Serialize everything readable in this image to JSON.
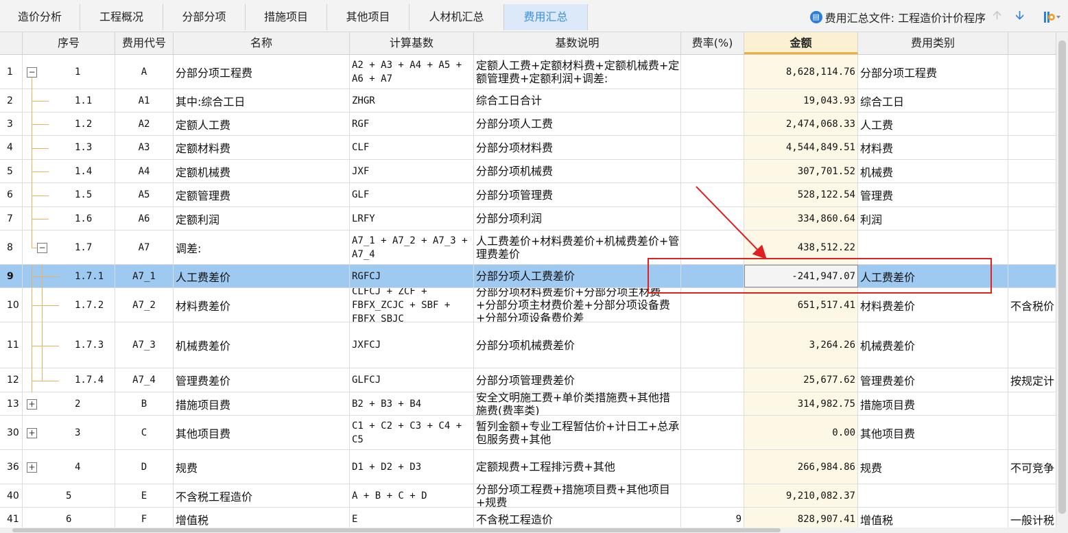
{
  "tabs": [
    {
      "label": "造价分析",
      "active": false
    },
    {
      "label": "工程概况",
      "active": false
    },
    {
      "label": "分部分项",
      "active": false
    },
    {
      "label": "措施项目",
      "active": false
    },
    {
      "label": "其他项目",
      "active": false
    },
    {
      "label": "人材机汇总",
      "active": false
    },
    {
      "label": "费用汇总",
      "active": true
    }
  ],
  "file_label": "费用汇总文件: 工程造价计价程序",
  "icons": {
    "file": "document-icon",
    "up": "arrow-up-icon",
    "down": "arrow-down-icon",
    "settings": "settings-icon"
  },
  "columns": [
    "",
    "序号",
    "费用代号",
    "名称",
    "计算基数",
    "基数说明",
    "费率(%)",
    "金额",
    "费用类别",
    ""
  ],
  "rows": [
    {
      "row": "1",
      "seq": "1",
      "code": "A",
      "name": "分部分项工程费",
      "base": "A2 + A3 + A4 + A5 + A6 + A7",
      "desc": "定额人工费+定额材料费+定额机械费+定额管理费+定额利润+调差:",
      "rate": "",
      "amount": "8,628,114.76",
      "category": "分部分项工程费",
      "note": ""
    },
    {
      "row": "2",
      "seq": "1.1",
      "code": "A1",
      "name": "其中:综合工日",
      "base": "ZHGR",
      "desc": "综合工日合计",
      "rate": "",
      "amount": "19,043.93",
      "category": "综合工日",
      "note": ""
    },
    {
      "row": "3",
      "seq": "1.2",
      "code": "A2",
      "name": "定额人工费",
      "base": "RGF",
      "desc": "分部分项人工费",
      "rate": "",
      "amount": "2,474,068.33",
      "category": "人工费",
      "note": ""
    },
    {
      "row": "4",
      "seq": "1.3",
      "code": "A3",
      "name": "定额材料费",
      "base": "CLF",
      "desc": "分部分项材料费",
      "rate": "",
      "amount": "4,544,849.51",
      "category": "材料费",
      "note": ""
    },
    {
      "row": "5",
      "seq": "1.4",
      "code": "A4",
      "name": "定额机械费",
      "base": "JXF",
      "desc": "分部分项机械费",
      "rate": "",
      "amount": "307,701.52",
      "category": "机械费",
      "note": ""
    },
    {
      "row": "6",
      "seq": "1.5",
      "code": "A5",
      "name": "定额管理费",
      "base": "GLF",
      "desc": "分部分项管理费",
      "rate": "",
      "amount": "528,122.54",
      "category": "管理费",
      "note": ""
    },
    {
      "row": "7",
      "seq": "1.6",
      "code": "A6",
      "name": "定额利润",
      "base": "LRFY",
      "desc": "分部分项利润",
      "rate": "",
      "amount": "334,860.64",
      "category": "利润",
      "note": ""
    },
    {
      "row": "8",
      "seq": "1.7",
      "code": "A7",
      "name": "调差:",
      "base": "A7_1 + A7_2 + A7_3 + A7_4",
      "desc": "人工费差价+材料费差价+机械费差价+管理费差价",
      "rate": "",
      "amount": "438,512.22",
      "category": "",
      "note": ""
    },
    {
      "row": "9",
      "seq": "1.7.1",
      "code": "A7_1",
      "name": "人工费差价",
      "base": "RGFCJ",
      "desc": "分部分项人工费差价",
      "rate": "",
      "amount": "-241,947.07",
      "category": "人工费差价",
      "note": ""
    },
    {
      "row": "10",
      "seq": "1.7.2",
      "code": "A7_2",
      "name": "材料费差价",
      "base": "CLFCJ + ZCF + FBFX_ZCJC + SBF + FBFX_SBJC",
      "desc": "分部分项材料费差价+分部分项主材费+分部分项主材费价差+分部分项设备费+分部分项设备费价差",
      "rate": "",
      "amount": "651,517.41",
      "category": "材料费差价",
      "note": "不含税价"
    },
    {
      "row": "11",
      "seq": "1.7.3",
      "code": "A7_3",
      "name": "机械费差价",
      "base": "JXFCJ",
      "desc": "分部分项机械费差价",
      "rate": "",
      "amount": "3,264.26",
      "category": "机械费差价",
      "note": ""
    },
    {
      "row": "12",
      "seq": "1.7.4",
      "code": "A7_4",
      "name": "管理费差价",
      "base": "GLFCJ",
      "desc": "分部分项管理费差价",
      "rate": "",
      "amount": "25,677.62",
      "category": "管理费差价",
      "note": "按规定计"
    },
    {
      "row": "13",
      "seq": "2",
      "code": "B",
      "name": "措施项目费",
      "base": "B2 + B3 + B4",
      "desc": "安全文明施工费+单价类措施费+其他措施费(费率类)",
      "rate": "",
      "amount": "314,982.75",
      "category": "措施项目费",
      "note": ""
    },
    {
      "row": "30",
      "seq": "3",
      "code": "C",
      "name": "其他项目费",
      "base": "C1 + C2 + C3 + C4 + C5",
      "desc": "暂列金额+专业工程暂估价+计日工+总承包服务费+其他",
      "rate": "",
      "amount": "0.00",
      "category": "其他项目费",
      "note": ""
    },
    {
      "row": "36",
      "seq": "4",
      "code": "D",
      "name": "规费",
      "base": "D1 + D2 + D3",
      "desc": "定额规费+工程排污费+其他",
      "rate": "",
      "amount": "266,984.86",
      "category": "规费",
      "note": "不可竞争"
    },
    {
      "row": "40",
      "seq": "5",
      "code": "E",
      "name": "不含税工程造价",
      "base": "A + B + C + D",
      "desc": "分部分项工程费+措施项目费+其他项目+规费",
      "rate": "",
      "amount": "9,210,082.37",
      "category": "",
      "note": ""
    },
    {
      "row": "41",
      "seq": "6",
      "code": "F",
      "name": "增值税",
      "base": "E",
      "desc": "不含税工程造价",
      "rate": "9",
      "amount": "828,907.41",
      "category": "增值税",
      "note": "一般计税"
    }
  ]
}
